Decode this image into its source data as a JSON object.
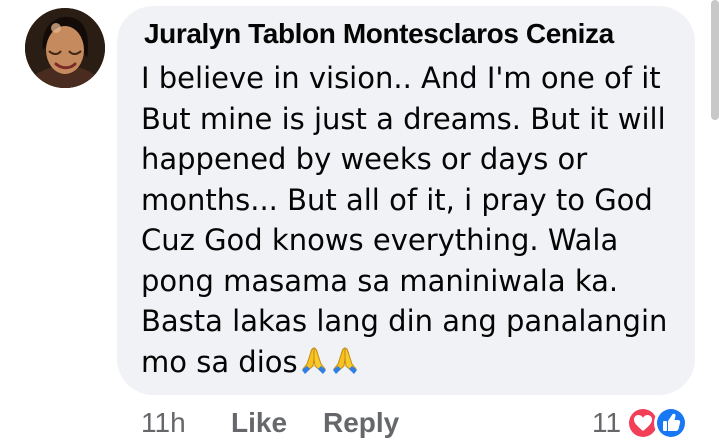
{
  "comment": {
    "author": "Juralyn Tablon Montesclaros Ceniza",
    "lines": [
      "I believe in vision.. And I'm one of it",
      "But mine is just a dreams. But it will",
      "happened by weeks or days or",
      "months... But all of it, i pray to God",
      "Cuz God knows everything. Wala",
      "pong masama sa maniniwala ka.",
      "Basta lakas lang din ang panalangin",
      "mo sa dios"
    ],
    "emojis": [
      "folded-hands",
      "folded-hands"
    ]
  },
  "actions": {
    "time": "11h",
    "like_label": "Like",
    "reply_label": "Reply"
  },
  "reactions": {
    "count": "11",
    "icons": [
      "love-reaction-icon",
      "like-reaction-icon"
    ]
  },
  "colors": {
    "bubble": "#f0f2f5",
    "primary_text": "#050505",
    "secondary_text": "#65676b",
    "love": "#f33e58",
    "like": "#1877f2"
  }
}
